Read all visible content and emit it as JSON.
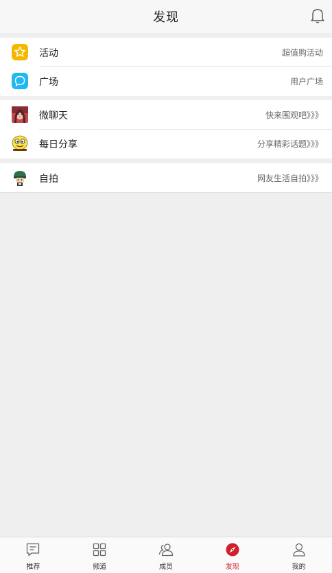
{
  "header": {
    "title": "发现",
    "icon": "bell-icon"
  },
  "groups": [
    {
      "items": [
        {
          "label": "活动",
          "right": "超值购活动",
          "icon": "star-icon",
          "icon_color": "#f5b800"
        },
        {
          "label": "广场",
          "right": "用户广场",
          "icon": "chat-bubble-icon",
          "icon_color": "#1fb8f0"
        }
      ]
    },
    {
      "items": [
        {
          "label": "微聊天",
          "right": "快来围观吧》》》",
          "icon": "girl-avatar-icon"
        },
        {
          "label": "每日分享",
          "right": "分享精彩话题》》》",
          "icon": "emoji-face-icon"
        }
      ]
    },
    {
      "items": [
        {
          "label": "自拍",
          "right": "网友生活自拍》》》",
          "icon": "cartoon-character-icon"
        }
      ]
    }
  ],
  "tabs": [
    {
      "label": "推荐",
      "icon": "recommend-icon",
      "active": false
    },
    {
      "label": "频道",
      "icon": "grid-icon",
      "active": false
    },
    {
      "label": "成员",
      "icon": "members-icon",
      "active": false
    },
    {
      "label": "发现",
      "icon": "compass-icon",
      "active": true
    },
    {
      "label": "我的",
      "icon": "user-icon",
      "active": false
    }
  ],
  "colors": {
    "accent": "#d0202a",
    "background": "#efefef"
  }
}
